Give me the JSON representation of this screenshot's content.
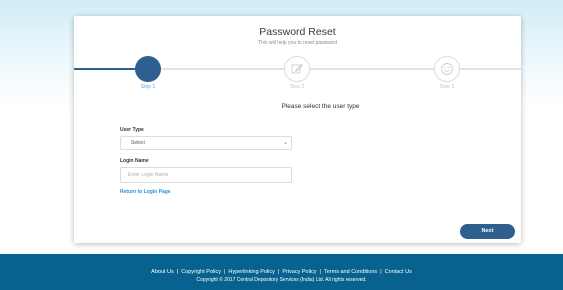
{
  "header": {
    "title": "Password Reset",
    "subtitle": "This will help you to reset password"
  },
  "steps": [
    {
      "label": "Step 1",
      "state": "active",
      "icon": "filled-circle"
    },
    {
      "label": "Step 2",
      "state": "pending",
      "icon": "edit-icon"
    },
    {
      "label": "Step 3",
      "state": "pending",
      "icon": "smiley-icon"
    }
  ],
  "form": {
    "prompt": "Please select the user type",
    "user_type_label": "User Type",
    "user_type_value": "Select",
    "login_name_label": "Login Name",
    "login_name_placeholder": "Enter Login Name",
    "return_link": "Return to Login Page",
    "next_button": "Next"
  },
  "footer": {
    "links": [
      "About Us",
      "Copyright Policy",
      "Hyperlinking Policy",
      "Privacy Policy",
      "Terms and Conditions",
      "Contact Us"
    ],
    "copyright": "Copyright © 2017 Central Depository Services (India) Ltd. All rights reserved."
  },
  "colors": {
    "primary": "#2f5f8e",
    "link": "#2b8fd6",
    "footer_bg": "#08628f"
  }
}
